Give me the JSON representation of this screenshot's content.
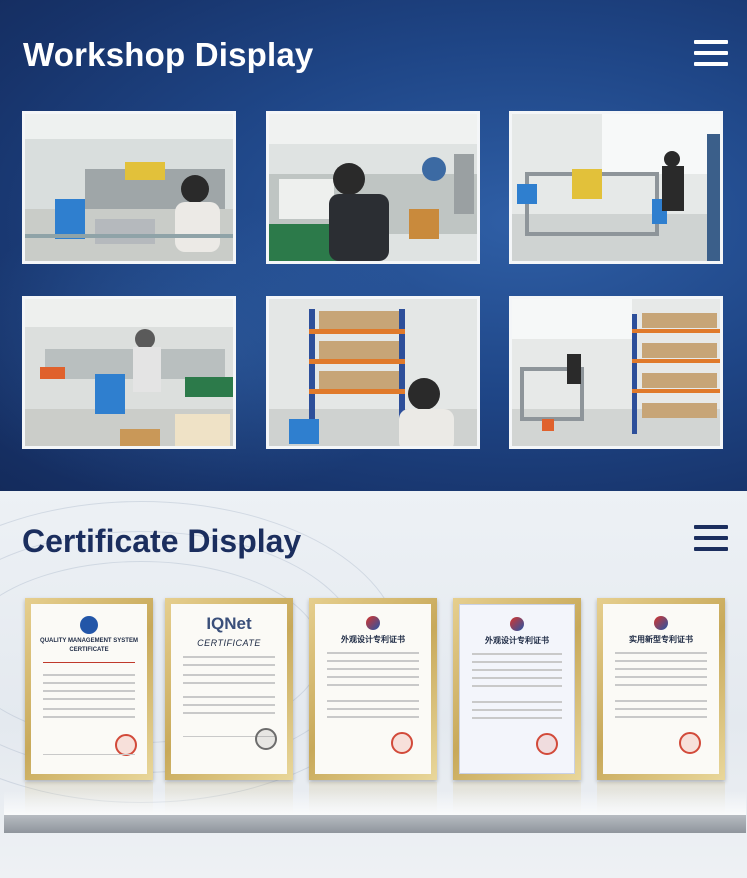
{
  "workshop": {
    "title": "Workshop Display",
    "menu_icon": "hamburger-menu-icon",
    "photos": [
      {
        "alt": "workshop-photo-1"
      },
      {
        "alt": "workshop-photo-2"
      },
      {
        "alt": "workshop-photo-3"
      },
      {
        "alt": "workshop-photo-4"
      },
      {
        "alt": "workshop-photo-5"
      },
      {
        "alt": "workshop-photo-6"
      }
    ]
  },
  "certificates": {
    "title": "Certificate Display",
    "menu_icon": "hamburger-menu-icon",
    "items": [
      {
        "heading": "QUALITY MANAGEMENT SYSTEM",
        "subheading": "CERTIFICATE",
        "logo": "CQC"
      },
      {
        "heading": "IQNet",
        "subheading": "CERTIFICATE",
        "logo": "IQNet"
      },
      {
        "heading": "外观设计专利证书",
        "subheading": "",
        "logo": "patent-office"
      },
      {
        "heading": "外观设计专利证书",
        "subheading": "",
        "logo": "patent-office"
      },
      {
        "heading": "实用新型专利证书",
        "subheading": "",
        "logo": "patent-office"
      }
    ]
  },
  "colors": {
    "workshop_bg": "#1f4687",
    "cert_title": "#1b2e5e",
    "frame_gold": "#c8a95a"
  }
}
